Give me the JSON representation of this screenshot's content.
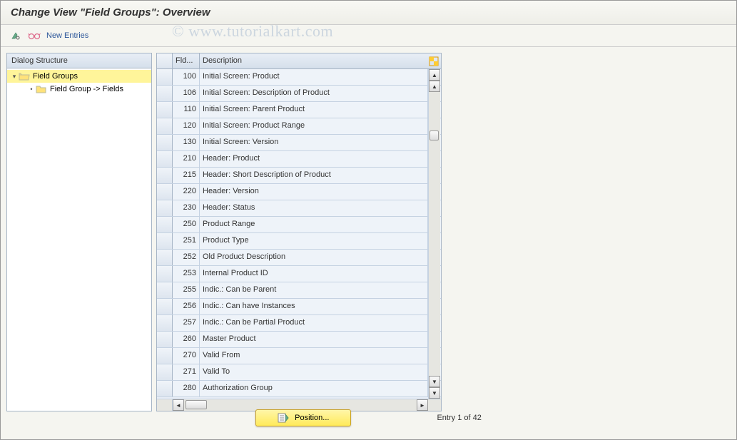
{
  "title": "Change View \"Field Groups\": Overview",
  "toolbar": {
    "new_entries": "New Entries"
  },
  "watermark": "© www.tutorialkart.com",
  "dialog_structure": {
    "header": "Dialog Structure",
    "root_label": "Field Groups",
    "child_label": "Field Group -> Fields"
  },
  "table": {
    "col_fld": "Fld...",
    "col_desc": "Description",
    "rows": [
      {
        "fld": "100",
        "desc": "Initial Screen: Product"
      },
      {
        "fld": "106",
        "desc": "Initial Screen: Description of Product"
      },
      {
        "fld": "110",
        "desc": "Initial Screen: Parent Product"
      },
      {
        "fld": "120",
        "desc": "Initial Screen: Product Range"
      },
      {
        "fld": "130",
        "desc": "Initial Screen: Version"
      },
      {
        "fld": "210",
        "desc": "Header: Product"
      },
      {
        "fld": "215",
        "desc": "Header: Short Description of Product"
      },
      {
        "fld": "220",
        "desc": "Header: Version"
      },
      {
        "fld": "230",
        "desc": "Header: Status"
      },
      {
        "fld": "250",
        "desc": "Product Range"
      },
      {
        "fld": "251",
        "desc": "Product Type"
      },
      {
        "fld": "252",
        "desc": "Old Product Description"
      },
      {
        "fld": "253",
        "desc": "Internal Product ID"
      },
      {
        "fld": "255",
        "desc": "Indic.: Can be Parent"
      },
      {
        "fld": "256",
        "desc": "Indic.: Can have Instances"
      },
      {
        "fld": "257",
        "desc": "Indic.: Can be Partial Product"
      },
      {
        "fld": "260",
        "desc": "Master Product"
      },
      {
        "fld": "270",
        "desc": "Valid From"
      },
      {
        "fld": "271",
        "desc": "Valid To"
      },
      {
        "fld": "280",
        "desc": "Authorization Group"
      }
    ]
  },
  "footer": {
    "position_label": "Position...",
    "entry_text": "Entry 1 of 42"
  }
}
